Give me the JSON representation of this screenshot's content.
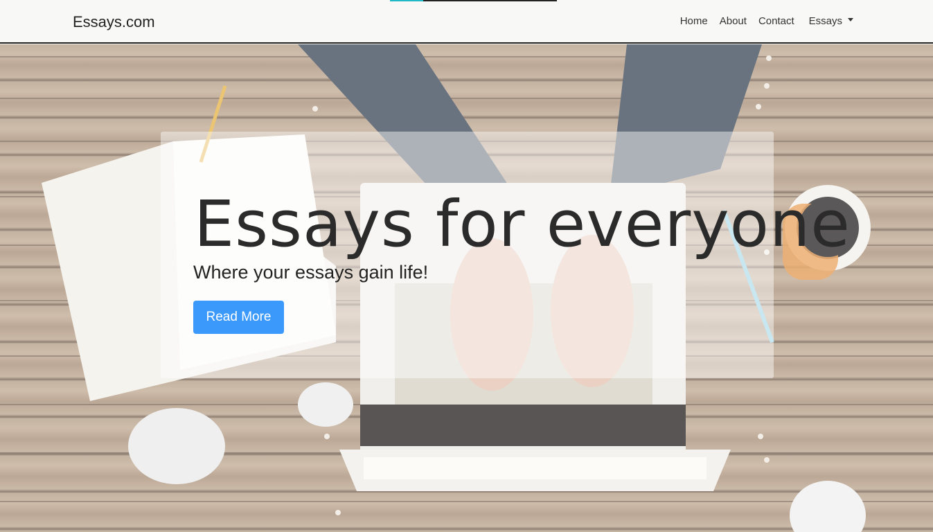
{
  "navbar": {
    "brand": "Essays.com",
    "links": [
      "Home",
      "About",
      "Contact"
    ],
    "dropdown_label": "Essays"
  },
  "hero": {
    "title": "Essays for everyone",
    "subtitle": "Where your essays gain life!",
    "button_label": "Read More"
  },
  "colors": {
    "accent": "#3b99fb",
    "progress": "#1fb8c4"
  },
  "icons": {
    "dropdown": "caret-down-icon"
  },
  "top_progress": 0.2
}
